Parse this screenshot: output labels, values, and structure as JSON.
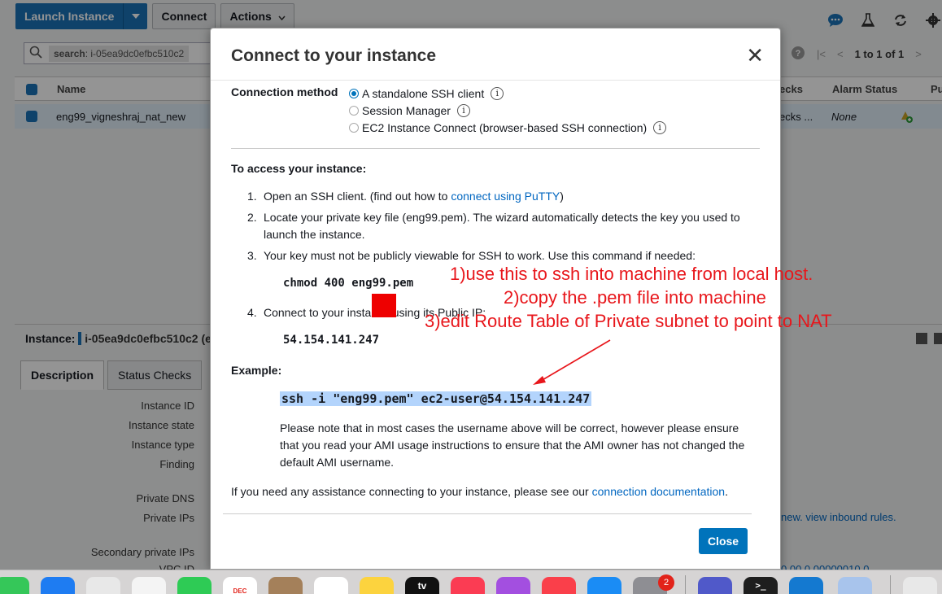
{
  "console": {
    "launch_label": "Launch Instance",
    "connect_label": "Connect",
    "actions_label": "Actions",
    "search_chip": "search",
    "search_value": ": i-05ea9dc0efbc510c2",
    "pager_text": "1 to 1 of 1",
    "columns": {
      "name": "Name",
      "checks": "ecks",
      "alarm": "Alarm Status",
      "pu": "Pu"
    },
    "row": {
      "name": "eng99_vigneshraj_nat_new",
      "checks": "ecks ...",
      "alarm": "None"
    },
    "instance_label": "Instance:",
    "instance_value": "i-05ea9dc0efbc510c2 (e",
    "tab_description": "Description",
    "tab_status": "Status Checks",
    "fields": [
      "Instance ID",
      "Instance state",
      "Instance type",
      "Finding",
      "Private DNS",
      "Private IPs",
      "Secondary private IPs",
      "VPC ID"
    ],
    "right_text": "new. view inbound rules.",
    "right_text_partial": "0.00.0.00000010.0"
  },
  "modal": {
    "title": "Connect to your instance",
    "close_symbol": "✕",
    "method_label": "Connection method",
    "methods": [
      {
        "label": "A standalone SSH client",
        "selected": true
      },
      {
        "label": "Session Manager",
        "selected": false
      },
      {
        "label": "EC2 Instance Connect (browser-based SSH connection)",
        "selected": false
      }
    ],
    "access_heading": "To access your instance:",
    "step1_num": "1.",
    "step1_text": "Open an SSH client. (find out how to",
    "step1_link": "connect using PuTTY",
    "step1_end": ")",
    "step2_num": "2.",
    "step2_text": "Locate your private key file (eng99.pem). The wizard automatically detects the key you used to launch the instance.",
    "step3_num": "3.",
    "step3_text": "Your key must not be publicly viewable for SSH to work. Use this command if needed:",
    "chmod_cmd": "chmod 400 eng99.pem",
    "step4_num": "4.",
    "step4_text": "Connect to your instance using its Public IP:",
    "public_ip": "54.154.141.247",
    "example_label": "Example:",
    "ssh_command": "ssh -i \"eng99.pem\" ec2-user@54.154.141.247",
    "note": "Please note that in most cases the username above will be correct, however please ensure that you read your AMI usage instructions to ensure that the AMI owner has not changed the default AMI username.",
    "assist_text": "If you need any assistance connecting to your instance, please see our",
    "assist_link": "connection documentation",
    "assist_end": ".",
    "close_button": "Close"
  },
  "annotations": {
    "line1": "1)use this to ssh into machine from local host.",
    "line2": "2)copy the .pem file into machine",
    "line3": "3)edit Route Table of Private subnet to point to NAT",
    "color": "#e8161b"
  },
  "dock": {
    "calendar_month": "DEC",
    "calendar_day": "20",
    "tv_label": "tv",
    "badge_count": "2",
    "terminal_glyph": ">_"
  }
}
